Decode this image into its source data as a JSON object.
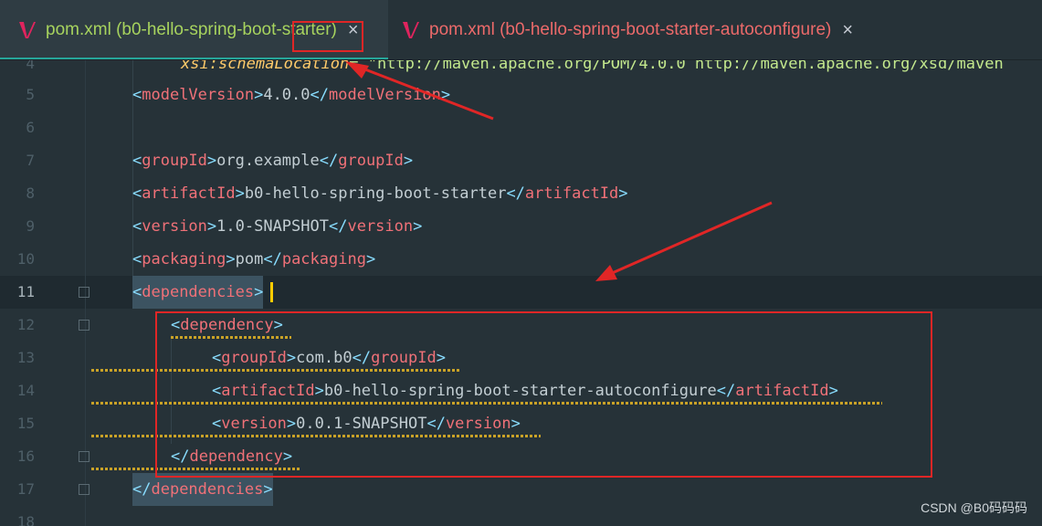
{
  "tabs": [
    {
      "label": "pom.xml (b0-hello-spring-boot-starter)",
      "active": true,
      "close": "×",
      "color": "#a7d35e"
    },
    {
      "label": "pom.xml (b0-hello-spring-boot-starter-autoconfigure)",
      "active": false,
      "close": "×",
      "color": "#ec6a6a"
    }
  ],
  "editor": {
    "line_numbers": [
      "4",
      "5",
      "6",
      "7",
      "8",
      "9",
      "10",
      "11",
      "12",
      "13",
      "14",
      "15",
      "16",
      "17",
      "18"
    ],
    "current_line": "11",
    "lines": {
      "l4_attr": "xsi:schemaLocation",
      "l4_rest": "= \"http://maven.apache.org/POM/4.0.0 http://maven.apache.org/xsd/maven",
      "modelVersion_tag": "modelVersion",
      "modelVersion_val": "4.0.0",
      "groupId_tag": "groupId",
      "groupId_val": "org.example",
      "artifactId_tag": "artifactId",
      "artifactId_val": "b0-hello-spring-boot-starter",
      "version_tag": "version",
      "version_val": "1.0-SNAPSHOT",
      "packaging_tag": "packaging",
      "packaging_val": "pom",
      "dependencies_tag": "dependencies",
      "dependency_tag": "dependency",
      "dep_groupId_val": "com.b0",
      "dep_artifactId_val": "b0-hello-spring-boot-starter-autoconfigure",
      "dep_version_val": "0.0.1-SNAPSHOT"
    }
  },
  "watermark": "CSDN @B0码码码",
  "colors": {
    "annotation": "#e02626",
    "tag": "#f07178",
    "bracket": "#89ddff",
    "text": "#c3ced3"
  }
}
